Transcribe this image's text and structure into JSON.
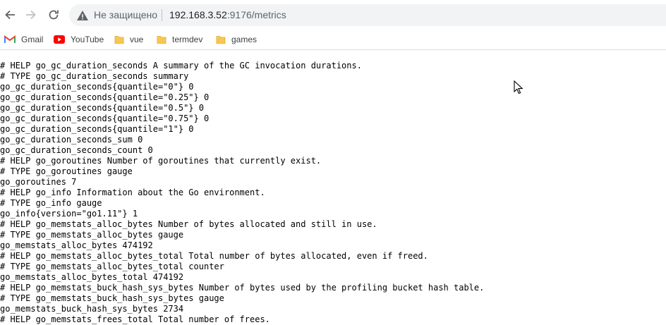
{
  "browser": {
    "security_label": "Не защищено",
    "url_host": "192.168.3.52",
    "url_rest": ":9176/metrics"
  },
  "bookmarks": [
    {
      "label": "Gmail",
      "icon": "gmail-icon"
    },
    {
      "label": "YouTube",
      "icon": "youtube-icon"
    },
    {
      "label": "vue",
      "icon": "folder-icon"
    },
    {
      "label": "termdev",
      "icon": "folder-icon"
    },
    {
      "label": "games",
      "icon": "folder-icon"
    }
  ],
  "colors": {
    "folder": "#f9c74f",
    "youtube": "#ff0000",
    "gmail_red": "#ea4335"
  },
  "metrics_lines": [
    "# HELP go_gc_duration_seconds A summary of the GC invocation durations.",
    "# TYPE go_gc_duration_seconds summary",
    "go_gc_duration_seconds{quantile=\"0\"} 0",
    "go_gc_duration_seconds{quantile=\"0.25\"} 0",
    "go_gc_duration_seconds{quantile=\"0.5\"} 0",
    "go_gc_duration_seconds{quantile=\"0.75\"} 0",
    "go_gc_duration_seconds{quantile=\"1\"} 0",
    "go_gc_duration_seconds_sum 0",
    "go_gc_duration_seconds_count 0",
    "# HELP go_goroutines Number of goroutines that currently exist.",
    "# TYPE go_goroutines gauge",
    "go_goroutines 7",
    "# HELP go_info Information about the Go environment.",
    "# TYPE go_info gauge",
    "go_info{version=\"go1.11\"} 1",
    "# HELP go_memstats_alloc_bytes Number of bytes allocated and still in use.",
    "# TYPE go_memstats_alloc_bytes gauge",
    "go_memstats_alloc_bytes 474192",
    "# HELP go_memstats_alloc_bytes_total Total number of bytes allocated, even if freed.",
    "# TYPE go_memstats_alloc_bytes_total counter",
    "go_memstats_alloc_bytes_total 474192",
    "# HELP go_memstats_buck_hash_sys_bytes Number of bytes used by the profiling bucket hash table.",
    "# TYPE go_memstats_buck_hash_sys_bytes gauge",
    "go_memstats_buck_hash_sys_bytes 2734",
    "# HELP go_memstats_frees_total Total number of frees."
  ]
}
